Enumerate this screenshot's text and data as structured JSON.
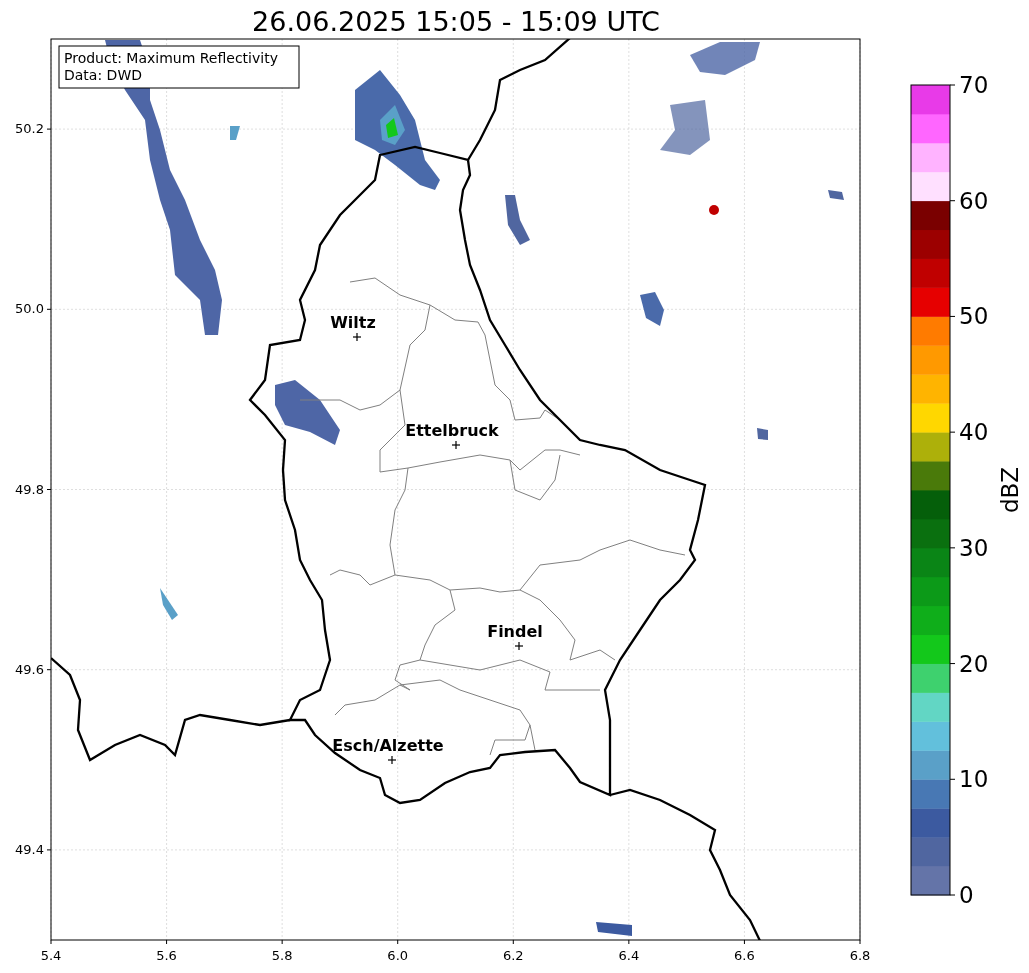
{
  "title": "26.06.2025 15:05 - 15:09 UTC",
  "info_box": {
    "lines": [
      "Product: Maximum Reflectivity",
      "Data: DWD"
    ]
  },
  "map": {
    "x_ticks": [
      "5.4",
      "5.6",
      "5.8",
      "6.0",
      "6.2",
      "6.4",
      "6.6",
      "6.8"
    ],
    "y_ticks": [
      "50.2",
      "50.0",
      "49.8",
      "49.6",
      "49.4"
    ],
    "cities": [
      {
        "name": "Wiltz"
      },
      {
        "name": "Ettelbruck"
      },
      {
        "name": "Findel"
      },
      {
        "name": "Esch/Alzette"
      }
    ]
  },
  "colorbar": {
    "label": "dBZ",
    "ticks": [
      "70",
      "60",
      "50",
      "40",
      "30",
      "20",
      "10",
      "0"
    ],
    "bands": [
      {
        "color": "#6474a8"
      },
      {
        "color": "#5066a0"
      },
      {
        "color": "#3c5aa0"
      },
      {
        "color": "#4878b4"
      },
      {
        "color": "#5aa0c8"
      },
      {
        "color": "#62c0dc"
      },
      {
        "color": "#62d6c4"
      },
      {
        "color": "#3ed16e"
      },
      {
        "color": "#13c81b"
      },
      {
        "color": "#0fae1a"
      },
      {
        "color": "#0c9a18"
      },
      {
        "color": "#0a8516"
      },
      {
        "color": "#0a700f"
      },
      {
        "color": "#055f0a"
      },
      {
        "color": "#4a7a0a"
      },
      {
        "color": "#adb00a"
      },
      {
        "color": "#ffd700"
      },
      {
        "color": "#ffb400"
      },
      {
        "color": "#ff9900"
      },
      {
        "color": "#ff7b00"
      },
      {
        "color": "#e60000"
      },
      {
        "color": "#c00000"
      },
      {
        "color": "#9c0000"
      },
      {
        "color": "#7a0000"
      },
      {
        "color": "#ffe0ff"
      },
      {
        "color": "#ffb3ff"
      },
      {
        "color": "#ff66ff"
      },
      {
        "color": "#e83ae8"
      }
    ]
  }
}
